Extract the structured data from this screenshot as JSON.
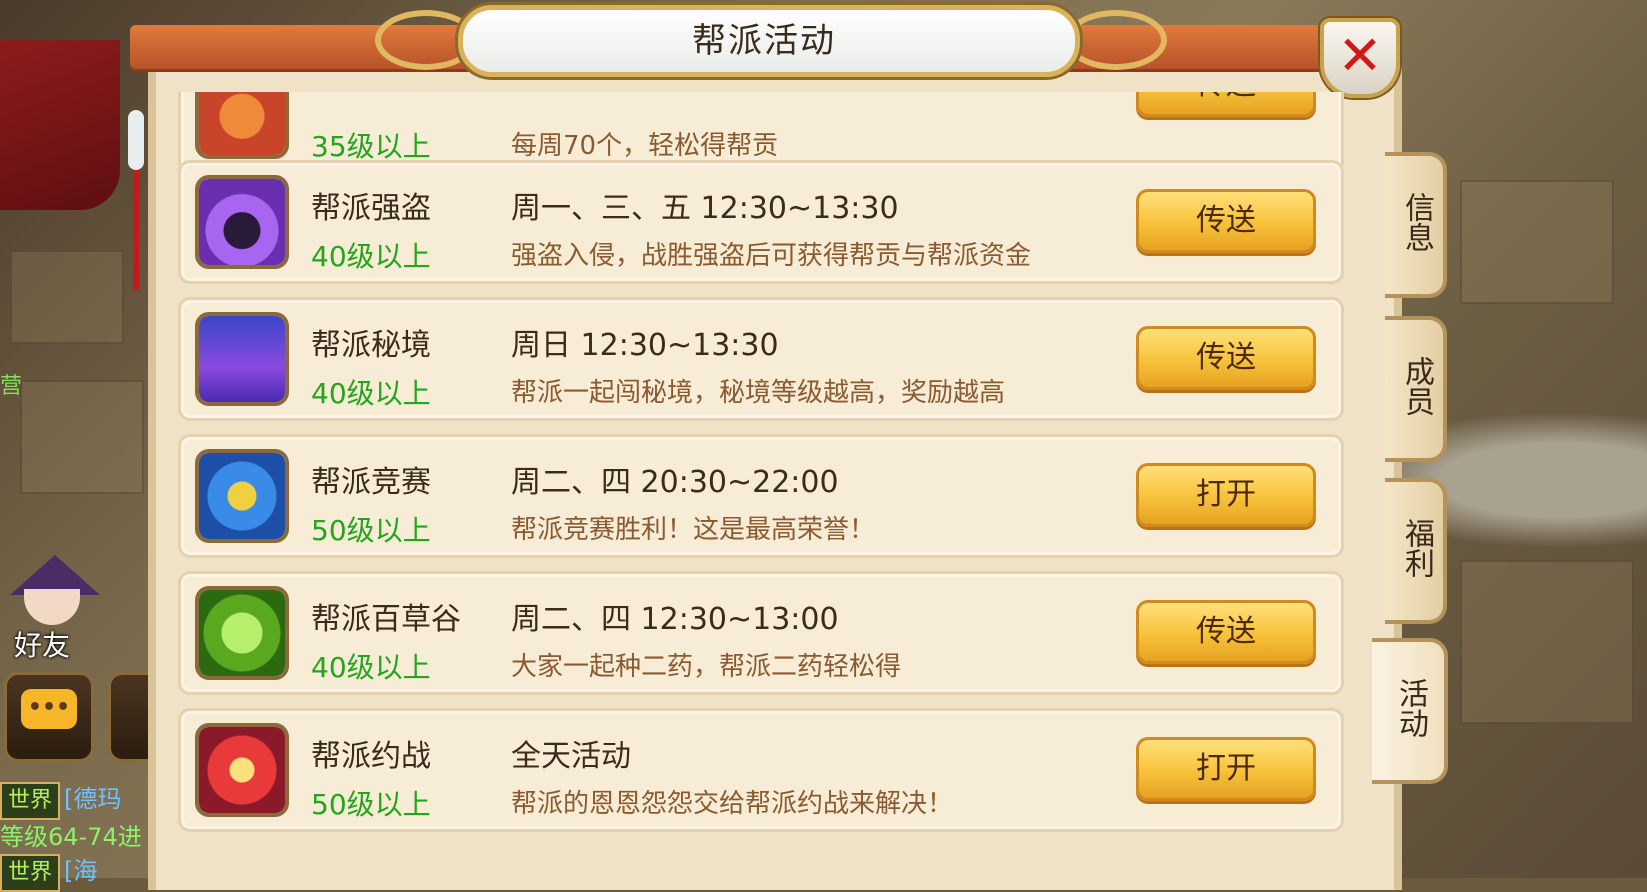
{
  "window": {
    "title": "帮派活动"
  },
  "scene": {
    "friend_label": "好友",
    "chat": [
      {
        "channel": "世界",
        "name": "[德玛",
        "text": ""
      },
      {
        "channel": "",
        "name": "",
        "text": "等级64-74进"
      },
      {
        "channel": "世界",
        "name": "[海",
        "text": ""
      }
    ],
    "side_text": "营"
  },
  "activities": [
    {
      "name": "",
      "level": "35级以上",
      "time": "",
      "desc": "每周70个，轻松得帮贡",
      "button": "传送",
      "icon": "banner-icon",
      "color": "#c8452a"
    },
    {
      "name": "帮派强盗",
      "level": "40级以上",
      "time": "周一、三、五 12:30~13:30",
      "desc": "强盗入侵，战胜强盗后可获得帮贡与帮派资金",
      "button": "传送",
      "icon": "bandit-icon",
      "color": "#7b3fc7"
    },
    {
      "name": "帮派秘境",
      "level": "40级以上",
      "time": "周日 12:30~13:30",
      "desc": "帮派一起闯秘境，秘境等级越高，奖励越高",
      "button": "传送",
      "icon": "pagoda-icon",
      "color": "#5b4ad1"
    },
    {
      "name": "帮派竞赛",
      "level": "50级以上",
      "time": "周二、四 20:30~22:00",
      "desc": "帮派竞赛胜利！这是最高荣誉！",
      "button": "打开",
      "icon": "scroll-icon",
      "color": "#2f6fd6"
    },
    {
      "name": "帮派百草谷",
      "level": "40级以上",
      "time": "周二、四 12:30~13:00",
      "desc": "大家一起种二药，帮派二药轻松得",
      "button": "传送",
      "icon": "herb-icon",
      "color": "#5aa81e"
    },
    {
      "name": "帮派约战",
      "level": "50级以上",
      "time": "全天活动",
      "desc": "帮派的恩恩怨怨交给帮派约战来解决！",
      "button": "打开",
      "icon": "duel-icon",
      "color": "#c82a2a"
    }
  ],
  "tabs": [
    {
      "label": "信息",
      "active": false
    },
    {
      "label": "成员",
      "active": false
    },
    {
      "label": "福利",
      "active": false
    },
    {
      "label": "活动",
      "active": true
    }
  ]
}
